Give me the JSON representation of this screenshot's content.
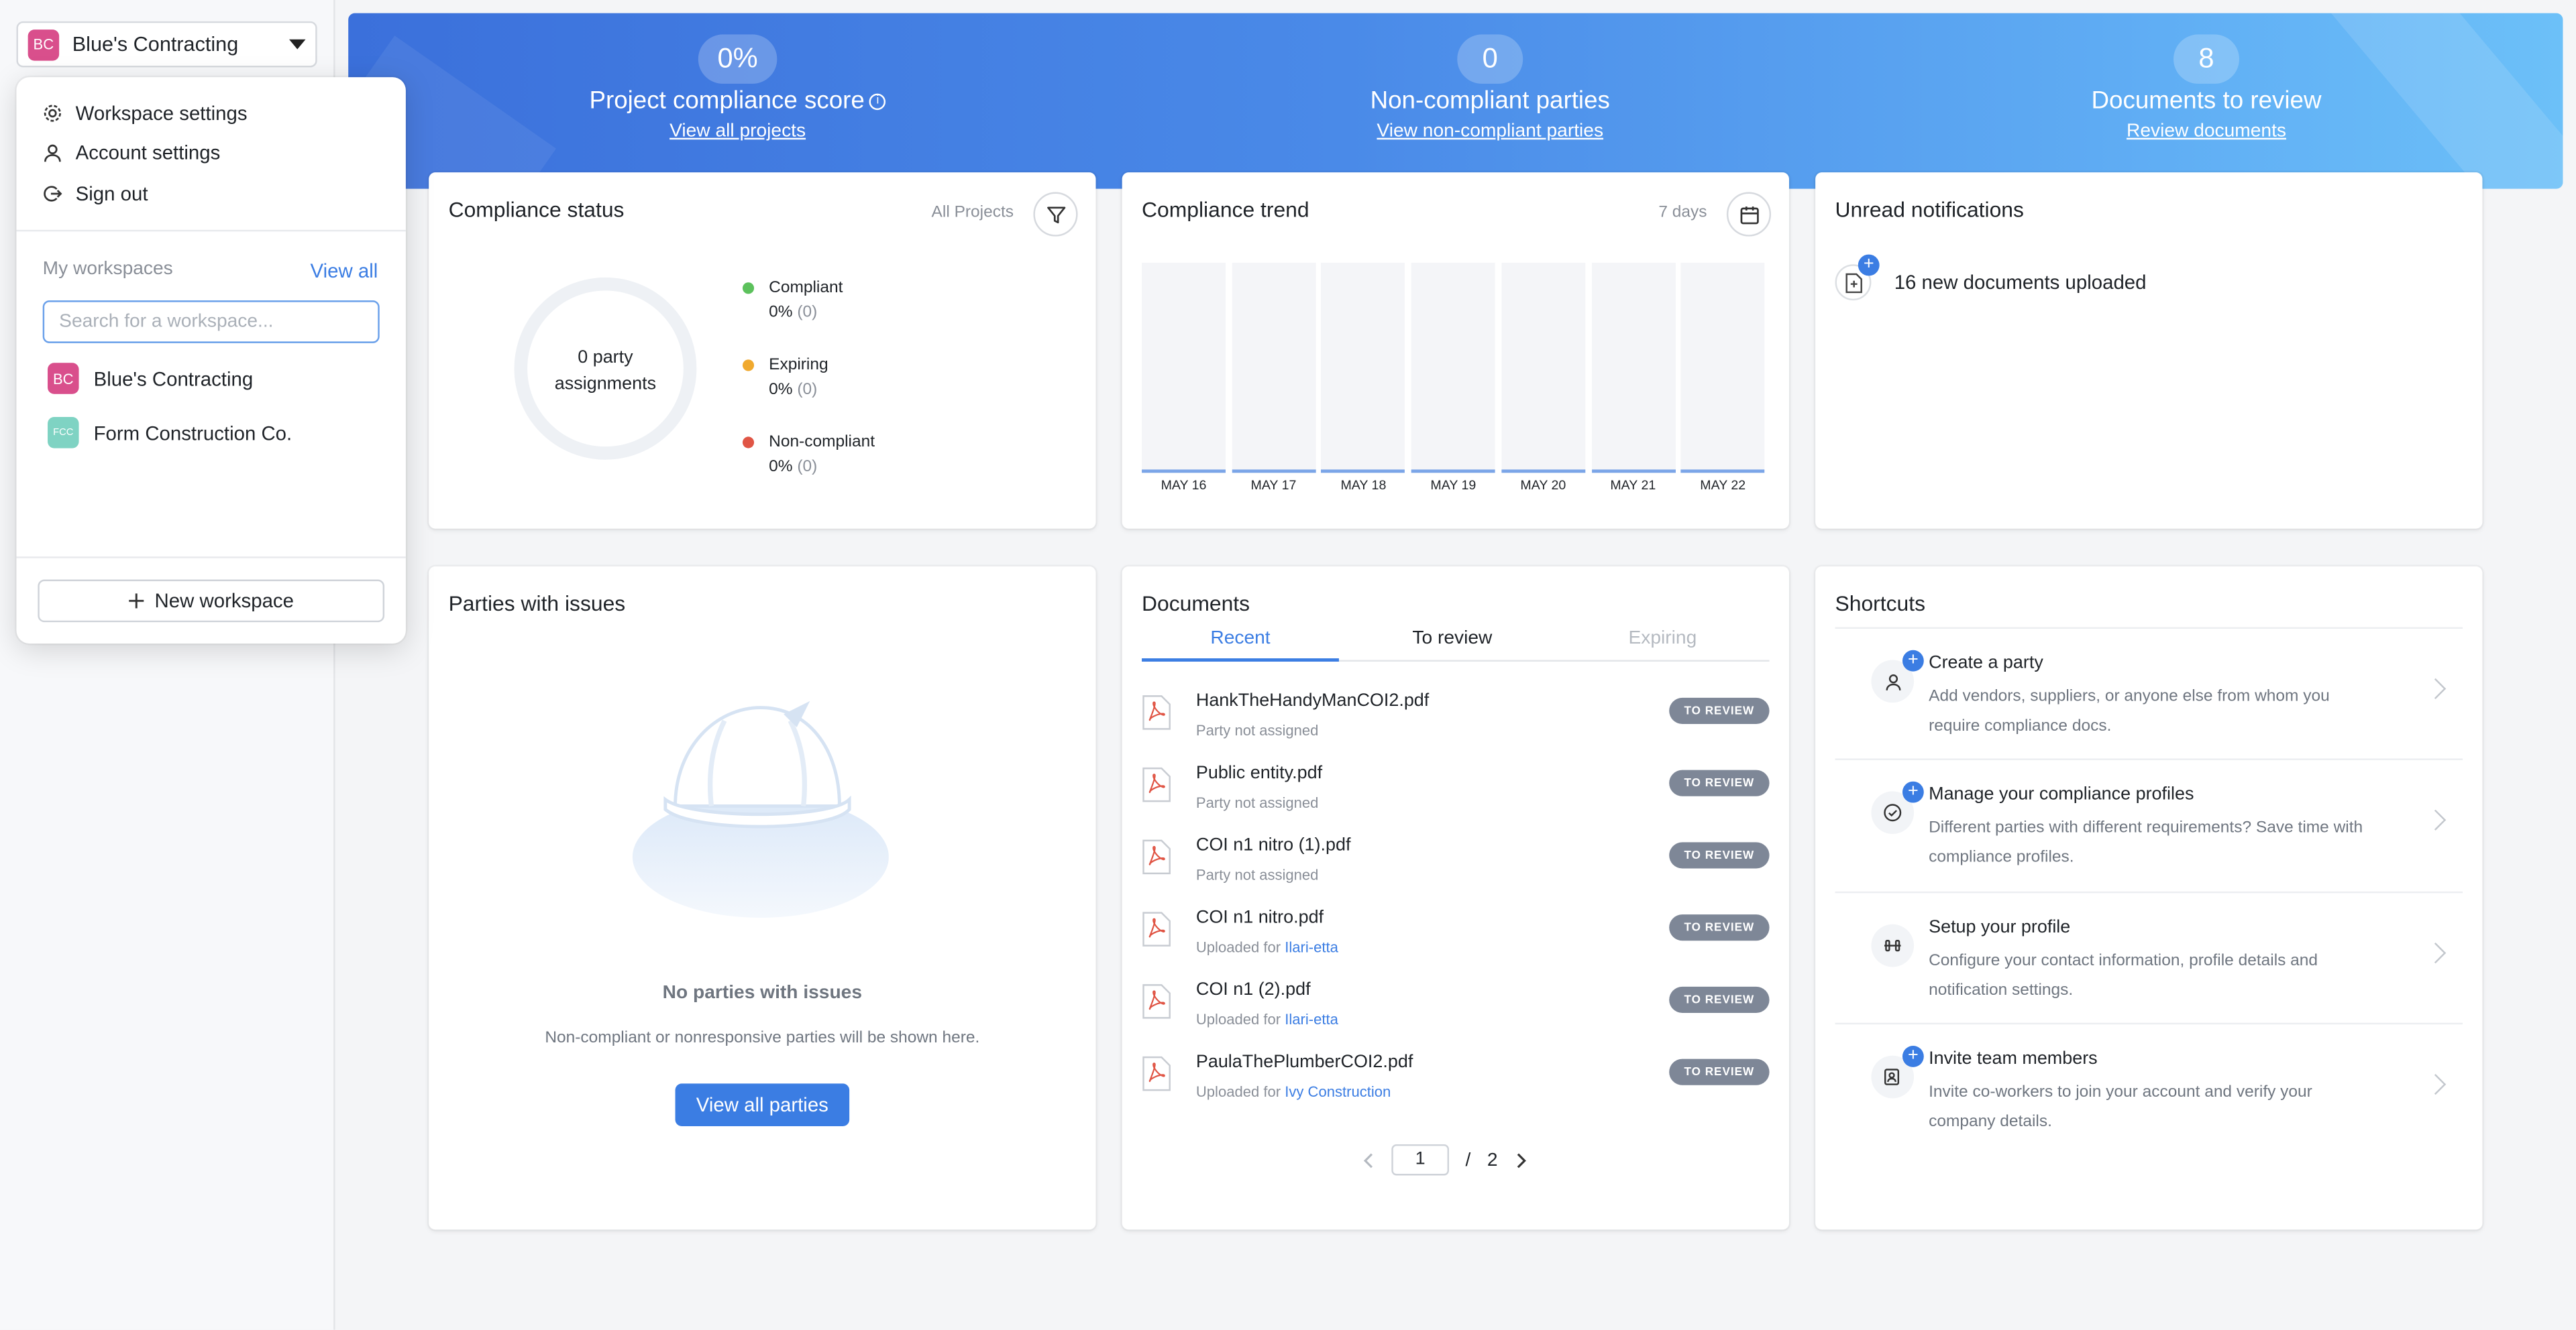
{
  "workspace": {
    "current_initials": "BC",
    "current_name": "Blue's Contracting"
  },
  "menu": {
    "workspace_settings": "Workspace settings",
    "account_settings": "Account settings",
    "sign_out": "Sign out",
    "my_workspaces": "My workspaces",
    "view_all": "View all",
    "search_placeholder": "Search for a workspace...",
    "workspaces": [
      {
        "initials": "BC",
        "name": "Blue's Contracting"
      },
      {
        "initials": "FCC",
        "name": "Form Construction Co."
      }
    ],
    "new_workspace": "New workspace"
  },
  "banner": {
    "score": {
      "value": "0%",
      "title": "Project compliance score",
      "link": "View all projects"
    },
    "noncompliant": {
      "value": "0",
      "title": "Non-compliant parties",
      "link": "View non-compliant parties"
    },
    "review": {
      "value": "8",
      "title": "Documents to review",
      "link": "Review documents"
    }
  },
  "compliance_status": {
    "title": "Compliance status",
    "filter_label": "All Projects",
    "center_line1": "0 party",
    "center_line2": "assignments",
    "legend": [
      {
        "label": "Compliant",
        "value": "0%",
        "count": "(0)",
        "color": "#5cc15c"
      },
      {
        "label": "Expiring",
        "value": "0%",
        "count": "(0)",
        "color": "#f0a92e"
      },
      {
        "label": "Non-compliant",
        "value": "0%",
        "count": "(0)",
        "color": "#e05545"
      }
    ]
  },
  "compliance_trend": {
    "title": "Compliance trend",
    "range_label": "7 days"
  },
  "chart_data": {
    "type": "bar",
    "categories": [
      "MAY 16",
      "MAY 17",
      "MAY 18",
      "MAY 19",
      "MAY 20",
      "MAY 21",
      "MAY 22"
    ],
    "values": [
      0,
      0,
      0,
      0,
      0,
      0,
      0
    ],
    "title": "Compliance trend",
    "xlabel": "",
    "ylabel": ""
  },
  "notifications": {
    "title": "Unread notifications",
    "items": [
      {
        "text": "16 new documents uploaded"
      }
    ]
  },
  "parties": {
    "title": "Parties with issues",
    "empty_title": "No parties with issues",
    "empty_sub": "Non-compliant or nonresponsive parties will be shown here.",
    "button": "View all parties"
  },
  "documents": {
    "title": "Documents",
    "tabs": [
      "Recent",
      "To review",
      "Expiring"
    ],
    "badge": "TO REVIEW",
    "rows": [
      {
        "name": "HankTheHandyManCOI2.pdf",
        "sub": "Party not assigned",
        "link": ""
      },
      {
        "name": "Public entity.pdf",
        "sub": "Party not assigned",
        "link": ""
      },
      {
        "name": "COI n1 nitro (1).pdf",
        "sub": "Party not assigned",
        "link": ""
      },
      {
        "name": "COI n1 nitro.pdf",
        "sub": "Uploaded for ",
        "link": "Ilari-etta"
      },
      {
        "name": "COI n1 (2).pdf",
        "sub": "Uploaded for ",
        "link": "Ilari-etta"
      },
      {
        "name": "PaulaThePlumberCOI2.pdf",
        "sub": "Uploaded for ",
        "link": "Ivy Construction"
      }
    ],
    "pager": {
      "current": "1",
      "separator": "/",
      "total": "2"
    }
  },
  "shortcuts": {
    "title": "Shortcuts",
    "items": [
      {
        "title": "Create a party",
        "desc": "Add vendors, suppliers, or anyone else from whom you require compliance docs."
      },
      {
        "title": "Manage your compliance profiles",
        "desc": "Different parties with different requirements? Save time with compliance profiles."
      },
      {
        "title": "Setup your profile",
        "desc": "Configure your contact information, profile details and notification settings."
      },
      {
        "title": "Invite team members",
        "desc": "Invite co-workers to join your account and verify your company details."
      }
    ]
  }
}
